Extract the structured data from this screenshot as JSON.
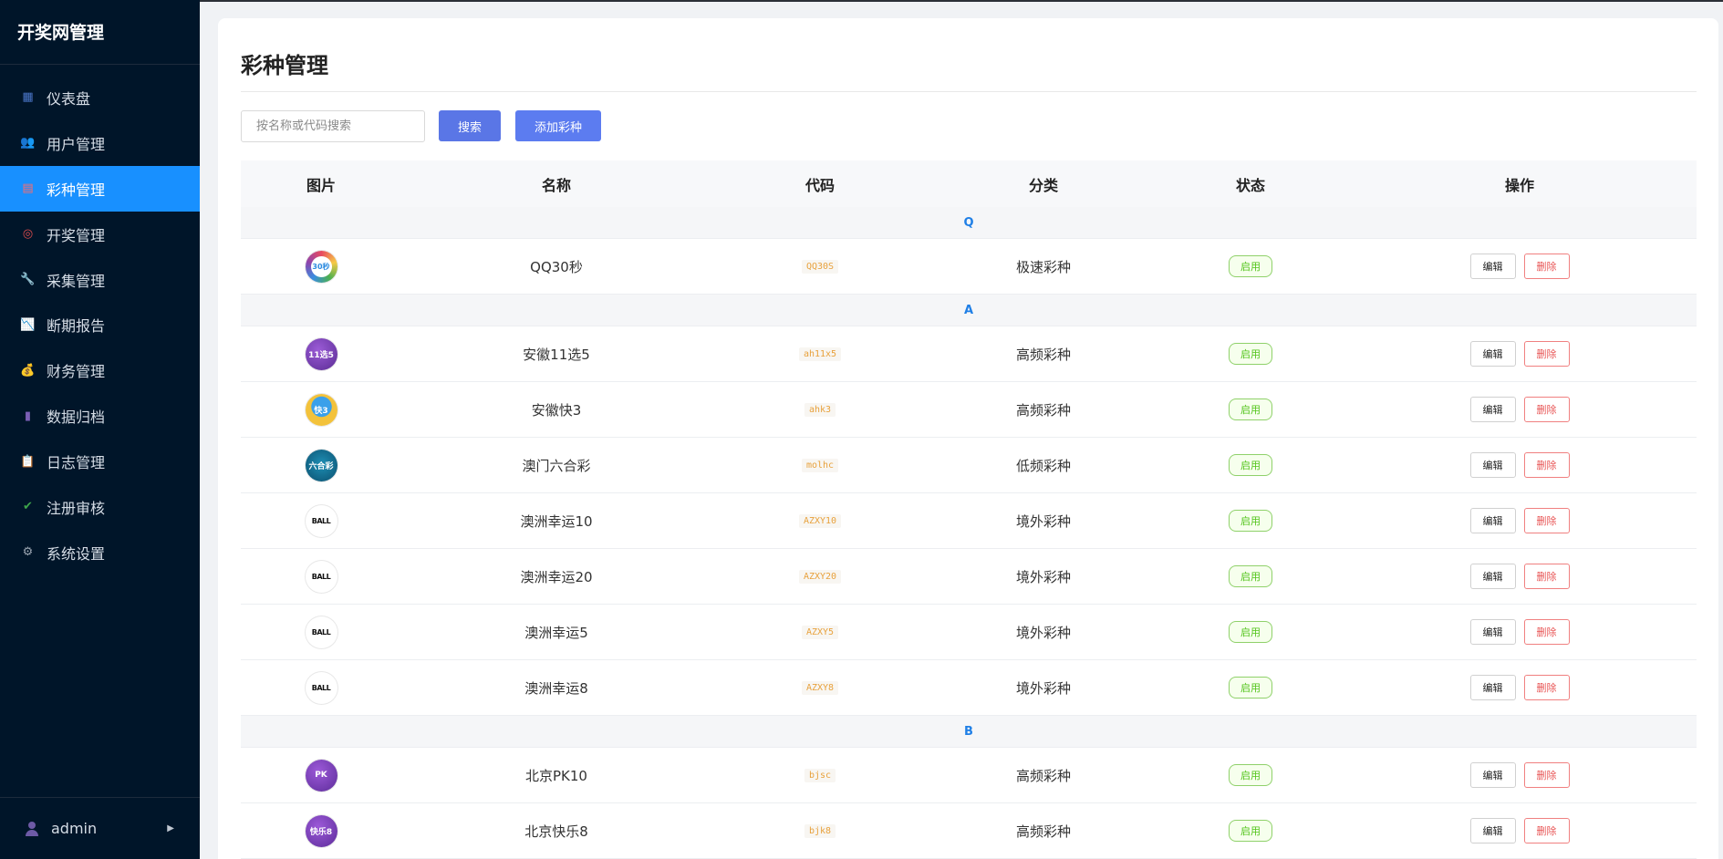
{
  "sidebar": {
    "brand": "开奖网管理",
    "items": [
      {
        "label": "仪表盘",
        "icon": "chart-icon",
        "color": "#4a76c8",
        "glyph": "▦"
      },
      {
        "label": "用户管理",
        "icon": "users-icon",
        "color": "#6d5aa6",
        "glyph": "👥"
      },
      {
        "label": "彩种管理",
        "icon": "lottery-icon",
        "color": "#ff6b6b",
        "glyph": "▤"
      },
      {
        "label": "开奖管理",
        "icon": "target-icon",
        "color": "#e04d4d",
        "glyph": "◎"
      },
      {
        "label": "采集管理",
        "icon": "wrench-icon",
        "color": "#8fa3b8",
        "glyph": "🔧"
      },
      {
        "label": "断期报告",
        "icon": "report-icon",
        "color": "#d4537d",
        "glyph": "📉"
      },
      {
        "label": "财务管理",
        "icon": "moneybag-icon",
        "color": "#d99a3b",
        "glyph": "💰"
      },
      {
        "label": "数据归档",
        "icon": "archive-icon",
        "color": "#7b5fb5",
        "glyph": "▮"
      },
      {
        "label": "日志管理",
        "icon": "clipboard-icon",
        "color": "#a8a8a8",
        "glyph": "📋"
      },
      {
        "label": "注册审核",
        "icon": "checkbox-icon",
        "color": "#3da54b",
        "glyph": "✔"
      },
      {
        "label": "系统设置",
        "icon": "gear-icon",
        "color": "#9aa5b1",
        "glyph": "⚙"
      }
    ],
    "active_index": 2,
    "user": "admin",
    "expand_glyph": "▶"
  },
  "main": {
    "title": "彩种管理",
    "search_placeholder": "按名称或代码搜索",
    "search_button": "搜索",
    "add_button": "添加彩种",
    "columns": [
      "图片",
      "名称",
      "代码",
      "分类",
      "状态",
      "操作"
    ],
    "groups": [
      {
        "letter": "Q",
        "rows": [
          {
            "name": "QQ30秒",
            "code": "QQ30S",
            "category": "极速彩种",
            "status": "启用",
            "logo": "qq",
            "logo_text": "30秒"
          }
        ]
      },
      {
        "letter": "A",
        "rows": [
          {
            "name": "安徽11选5",
            "code": "ah11x5",
            "category": "高频彩种",
            "status": "启用",
            "logo": "purple",
            "logo_text": "11选5"
          },
          {
            "name": "安徽快3",
            "code": "ahk3",
            "category": "高频彩种",
            "status": "启用",
            "logo": "yellow",
            "logo_text": "快3"
          },
          {
            "name": "澳门六合彩",
            "code": "molhc",
            "category": "低频彩种",
            "status": "启用",
            "logo": "teal",
            "logo_text": "六合彩"
          },
          {
            "name": "澳洲幸运10",
            "code": "AZXY10",
            "category": "境外彩种",
            "status": "启用",
            "logo": "ball",
            "logo_text": "BALL"
          },
          {
            "name": "澳洲幸运20",
            "code": "AZXY20",
            "category": "境外彩种",
            "status": "启用",
            "logo": "ball-green",
            "logo_text": "BALL"
          },
          {
            "name": "澳洲幸运5",
            "code": "AZXY5",
            "category": "境外彩种",
            "status": "启用",
            "logo": "ball",
            "logo_text": "BALL"
          },
          {
            "name": "澳洲幸运8",
            "code": "AZXY8",
            "category": "境外彩种",
            "status": "启用",
            "logo": "ball-blue",
            "logo_text": "BALL"
          }
        ]
      },
      {
        "letter": "B",
        "rows": [
          {
            "name": "北京PK10",
            "code": "bjsc",
            "category": "高频彩种",
            "status": "启用",
            "logo": "bj",
            "logo_text": "PK"
          },
          {
            "name": "北京快乐8",
            "code": "bjk8",
            "category": "高频彩种",
            "status": "启用",
            "logo": "bj",
            "logo_text": "快乐8"
          }
        ]
      }
    ],
    "edit_label": "编辑",
    "delete_label": "删除"
  }
}
